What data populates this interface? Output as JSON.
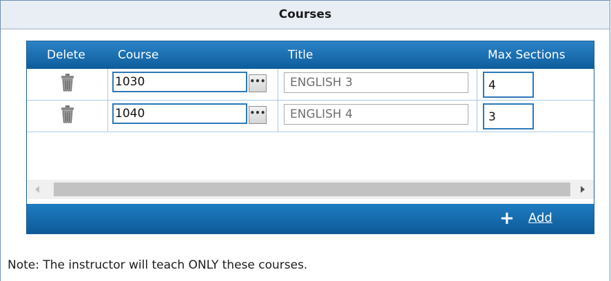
{
  "panel": {
    "title": "Courses"
  },
  "grid": {
    "columns": {
      "delete": "Delete",
      "course": "Course",
      "title": "Title",
      "max_sections": "Max Sections"
    },
    "rows": [
      {
        "course": "1030",
        "ellipsis": "•••",
        "title": "ENGLISH 3",
        "max_sections": "4"
      },
      {
        "course": "1040",
        "ellipsis": "•••",
        "title": "ENGLISH 4",
        "max_sections": "3"
      }
    ],
    "footer": {
      "add_icon": "plus-icon",
      "add_label": "Add"
    }
  },
  "note": "Note: The instructor will teach ONLY these courses.",
  "colors": {
    "header_blue": "#1a6fb0",
    "border_blue": "#2a78b8",
    "panel_header_bg": "#e8eef4"
  }
}
